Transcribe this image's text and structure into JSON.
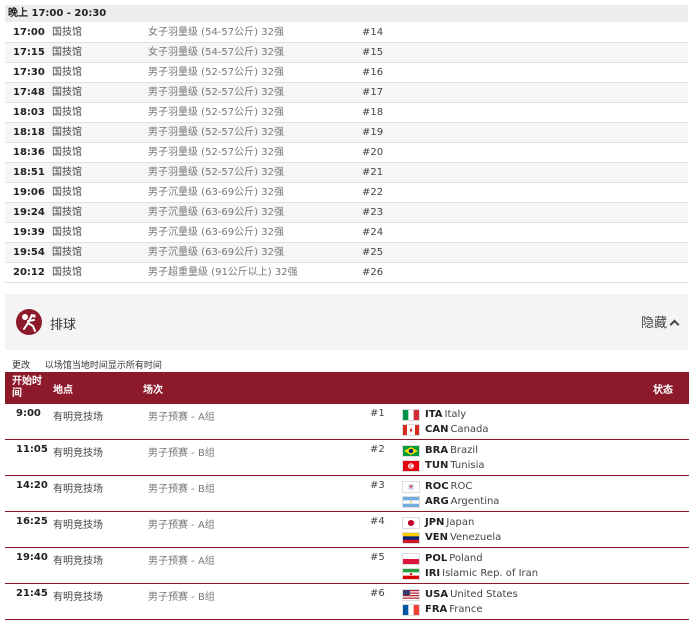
{
  "boxing": {
    "session_label": "晚上  17:00 - 20:30",
    "rows": [
      {
        "time": "17:00",
        "venue": "国技馆",
        "event": "女子羽量级 (54-57公斤) 32强",
        "num": "#14"
      },
      {
        "time": "17:15",
        "venue": "国技馆",
        "event": "女子羽量级 (54-57公斤) 32强",
        "num": "#15"
      },
      {
        "time": "17:30",
        "venue": "国技馆",
        "event": "男子羽量级 (52-57公斤) 32强",
        "num": "#16"
      },
      {
        "time": "17:48",
        "venue": "国技馆",
        "event": "男子羽量级 (52-57公斤) 32强",
        "num": "#17"
      },
      {
        "time": "18:03",
        "venue": "国技馆",
        "event": "男子羽量级 (52-57公斤) 32强",
        "num": "#18"
      },
      {
        "time": "18:18",
        "venue": "国技馆",
        "event": "男子羽量级 (52-57公斤) 32强",
        "num": "#19"
      },
      {
        "time": "18:36",
        "venue": "国技馆",
        "event": "男子羽量级 (52-57公斤) 32强",
        "num": "#20"
      },
      {
        "time": "18:51",
        "venue": "国技馆",
        "event": "男子羽量级 (52-57公斤) 32强",
        "num": "#21"
      },
      {
        "time": "19:06",
        "venue": "国技馆",
        "event": "男子沉量级 (63-69公斤) 32强",
        "num": "#22"
      },
      {
        "time": "19:24",
        "venue": "国技馆",
        "event": "男子沉量级 (63-69公斤) 32强",
        "num": "#23"
      },
      {
        "time": "19:39",
        "venue": "国技馆",
        "event": "男子沉量级 (63-69公斤) 32强",
        "num": "#24"
      },
      {
        "time": "19:54",
        "venue": "国技馆",
        "event": "男子沉量级 (63-69公斤) 32强",
        "num": "#25"
      },
      {
        "time": "20:12",
        "venue": "国技馆",
        "event": "男子超重量级 (91公斤以上) 32强",
        "num": "#26"
      }
    ]
  },
  "volleyball": {
    "title": "排球",
    "icon": "volleyball-icon",
    "hide_label": "隐藏",
    "change_label": "更改",
    "tz_label": "以场馆当地时间显示所有时间",
    "brand_color": "#8c1a2a",
    "headers": {
      "time": "开始时间",
      "venue": "地点",
      "event": "场次",
      "status": "状态"
    },
    "matches": [
      {
        "time": "9:00",
        "venue": "有明竞技场",
        "event": "男子预赛 - A组",
        "num": "#1",
        "team1": {
          "code": "ITA",
          "name": "Italy",
          "flag": "ita"
        },
        "team2": {
          "code": "CAN",
          "name": "Canada",
          "flag": "can"
        }
      },
      {
        "time": "11:05",
        "venue": "有明竞技场",
        "event": "男子预赛 - B组",
        "num": "#2",
        "team1": {
          "code": "BRA",
          "name": "Brazil",
          "flag": "bra"
        },
        "team2": {
          "code": "TUN",
          "name": "Tunisia",
          "flag": "tun"
        }
      },
      {
        "time": "14:20",
        "venue": "有明竞技场",
        "event": "男子预赛 - B组",
        "num": "#3",
        "team1": {
          "code": "ROC",
          "name": "ROC",
          "flag": "roc"
        },
        "team2": {
          "code": "ARG",
          "name": "Argentina",
          "flag": "arg"
        }
      },
      {
        "time": "16:25",
        "venue": "有明竞技场",
        "event": "男子预赛 - A组",
        "num": "#4",
        "team1": {
          "code": "JPN",
          "name": "Japan",
          "flag": "jpn"
        },
        "team2": {
          "code": "VEN",
          "name": "Venezuela",
          "flag": "ven"
        }
      },
      {
        "time": "19:40",
        "venue": "有明竞技场",
        "event": "男子预赛 - A组",
        "num": "#5",
        "team1": {
          "code": "POL",
          "name": "Poland",
          "flag": "pol"
        },
        "team2": {
          "code": "IRI",
          "name": "Islamic Rep. of Iran",
          "flag": "iri"
        }
      },
      {
        "time": "21:45",
        "venue": "有明竞技场",
        "event": "男子预赛 - B组",
        "num": "#6",
        "team1": {
          "code": "USA",
          "name": "United States",
          "flag": "usa"
        },
        "team2": {
          "code": "FRA",
          "name": "France",
          "flag": "fra"
        }
      }
    ]
  }
}
